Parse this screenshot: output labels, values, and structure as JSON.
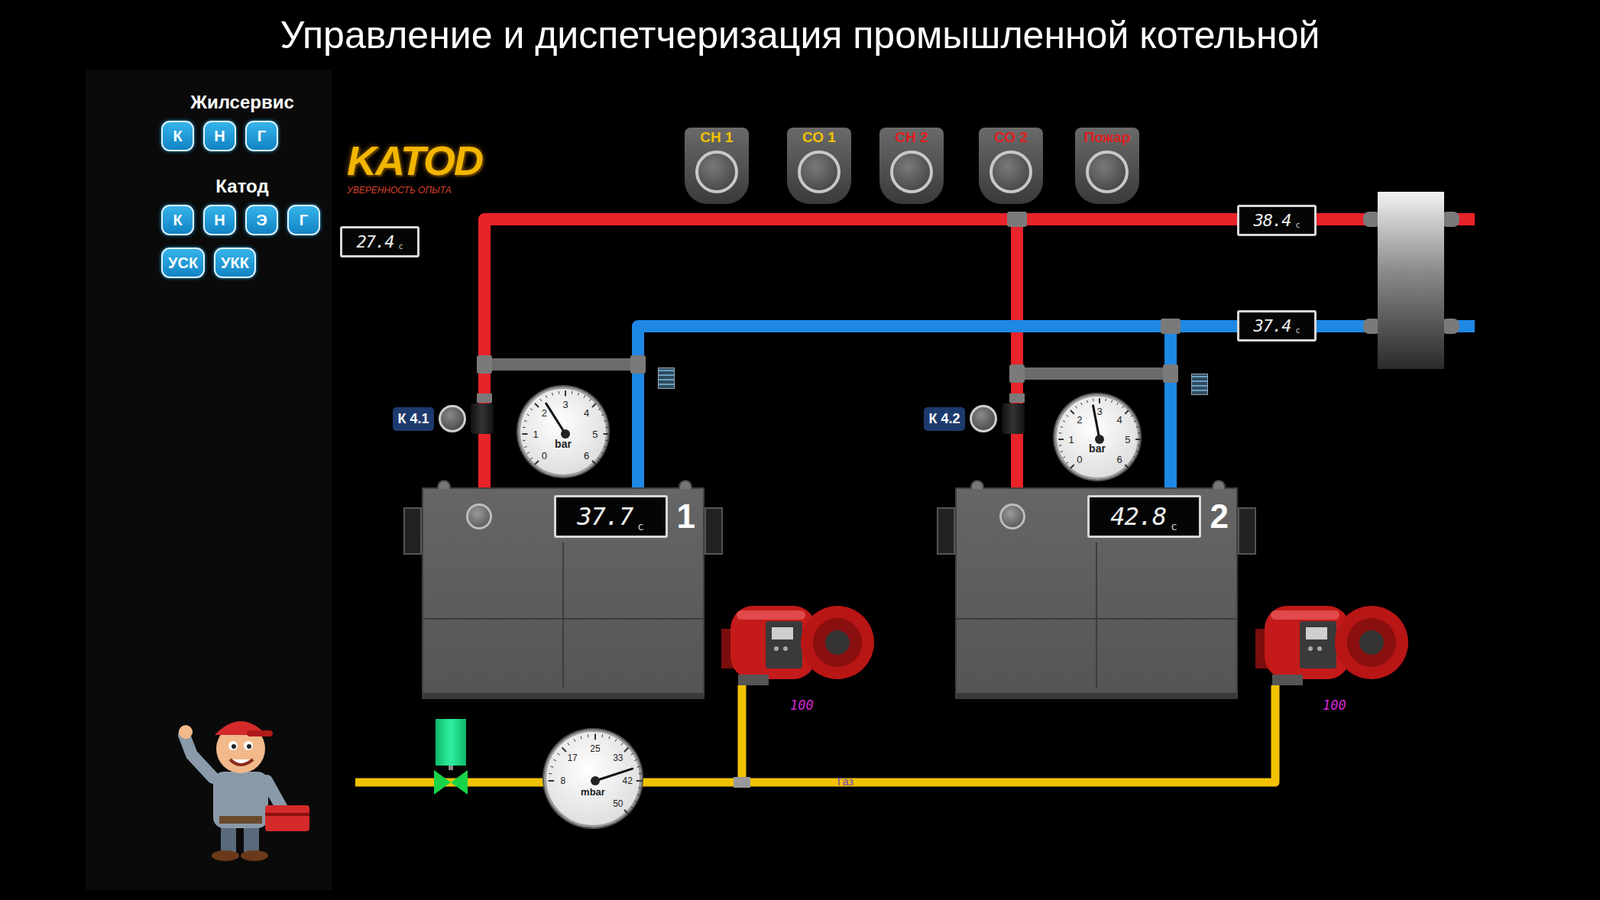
{
  "title": "Управление и диспетчеризация промышленной котельной",
  "sidebar": {
    "groups": [
      {
        "name": "Жилсервис",
        "buttons": [
          "К",
          "Н",
          "Г"
        ]
      },
      {
        "name": "Катод",
        "buttons": [
          "К",
          "Н",
          "Э",
          "Г",
          "УСК",
          "УКК"
        ]
      }
    ]
  },
  "logo": {
    "name": "KATOD",
    "slogan": "УВЕРЕННОСТЬ ОПЫТА"
  },
  "alarms": [
    {
      "label": "СН 1",
      "color": "#f2c200",
      "on": false
    },
    {
      "label": "СО 1",
      "color": "#f2c200",
      "on": false
    },
    {
      "label": "СН 2",
      "color": "#e02020",
      "on": false
    },
    {
      "label": "СО 2",
      "color": "#e02020",
      "on": false
    },
    {
      "label": "Пожар",
      "color": "#e02020",
      "on": false
    }
  ],
  "outdoor": {
    "value": "27.4",
    "unit": "c"
  },
  "supply": {
    "value": "38.4",
    "unit": "c"
  },
  "return": {
    "value": "37.4",
    "unit": "c"
  },
  "boilers": [
    {
      "number": "1",
      "temperature": "37.7",
      "unit": "c",
      "pump": "К 4.1",
      "pressure": {
        "ticks": [
          "0",
          "1",
          "2",
          "3",
          "4",
          "5",
          "6"
        ],
        "unit": "bar",
        "level": 0.38
      },
      "burner_power": "100"
    },
    {
      "number": "2",
      "temperature": "42.8",
      "unit": "c",
      "pump": "К 4.2",
      "pressure": {
        "ticks": [
          "0",
          "1",
          "2",
          "3",
          "4",
          "5",
          "6"
        ],
        "unit": "bar",
        "level": 0.46
      },
      "burner_power": "100"
    }
  ],
  "gas": {
    "label": "Газ",
    "valve": {
      "open": true
    },
    "pressure": {
      "ticks": [
        "8",
        "17",
        "25",
        "33",
        "42",
        "50"
      ],
      "unit": "mbar",
      "level": 0.72
    }
  }
}
